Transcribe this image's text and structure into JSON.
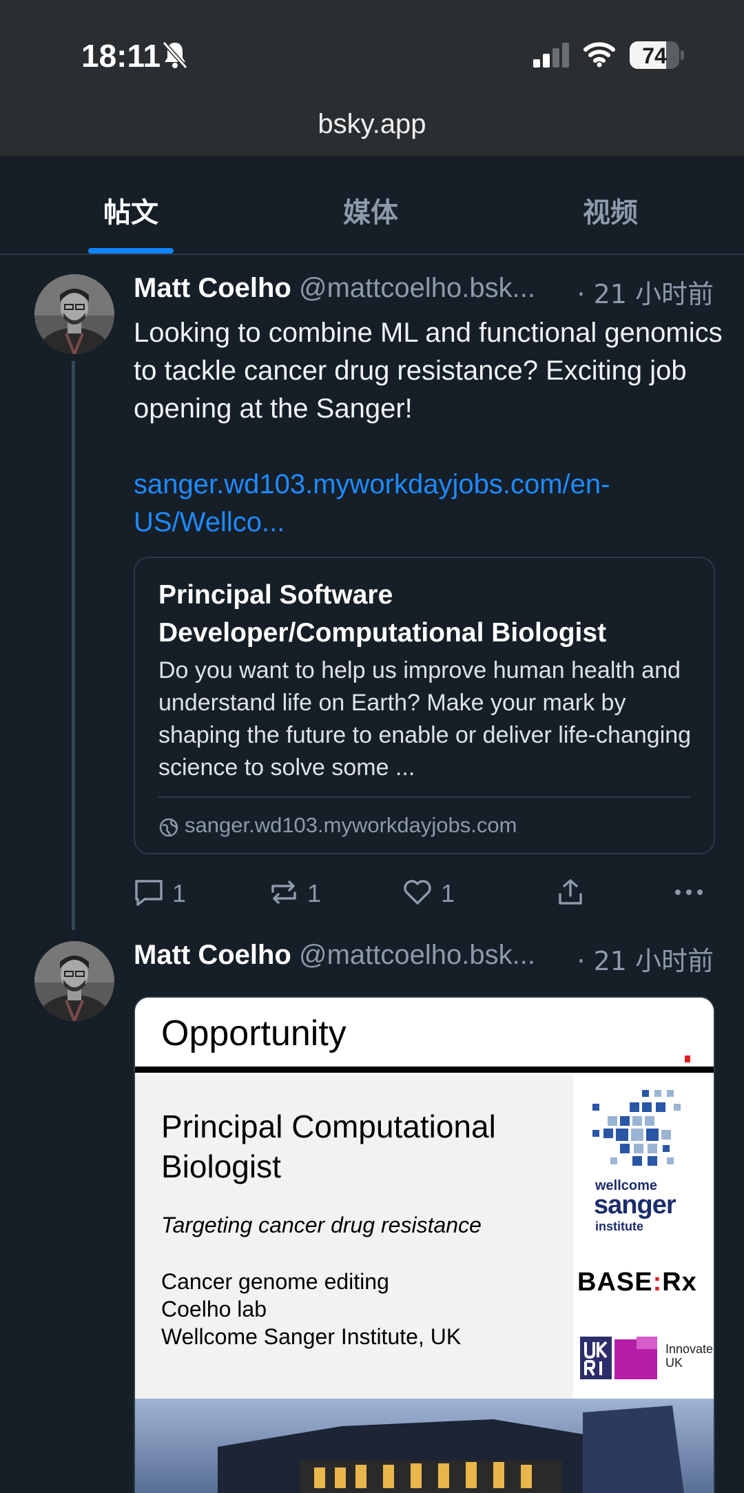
{
  "status_bar": {
    "time": "18:11",
    "battery_level": "74",
    "battery_fraction": 0.74,
    "icons": [
      "bell-slash-icon",
      "cellular-signal-icon",
      "wifi-icon",
      "battery-icon"
    ]
  },
  "browser": {
    "url": "bsky.app"
  },
  "tabs": [
    {
      "label": "帖文",
      "active": true
    },
    {
      "label": "媒体",
      "active": false
    },
    {
      "label": "视频",
      "active": false
    }
  ],
  "posts": [
    {
      "author": "Matt Coelho",
      "handle": "@mattcoelho.bsk...",
      "time": "· 21 小时前",
      "text": "Looking to combine ML and functional genomics to tackle cancer drug resistance? Exciting job opening at the Sanger!",
      "link": "sanger.wd103.myworkdayjobs.com/en-US/Wellco...",
      "card": {
        "title": "Principal Software Developer/Computational Biologist",
        "description": "Do you want to help us improve human health and understand life on Earth? Make your mark by shaping the future to enable or deliver life-changing science to solve some ...",
        "domain": "sanger.wd103.myworkdayjobs.com"
      },
      "actions": {
        "reply_count": "1",
        "repost_count": "1",
        "like_count": "1"
      }
    },
    {
      "author": "Matt Coelho",
      "handle": "@mattcoelho.bsk...",
      "time": "· 21 小时前",
      "image": {
        "heading": "Opportunity",
        "title": "Principal Computational Biologist",
        "subtitle": "Targeting cancer drug resistance",
        "lines": "Cancer genome editing\nCoelho lab\nWellcome Sanger Institute, UK",
        "logo_wellcome": "wellcome",
        "logo_sanger": "sanger",
        "logo_institute": "institute",
        "logo_base_left": "BASE",
        "logo_base_colon": ":",
        "logo_base_right": "Rx",
        "logo_innovate": "Innovate\nUK"
      }
    }
  ],
  "colors": {
    "background": "#161e27",
    "accent": "#1083fe",
    "link": "#1e8bff",
    "muted": "#8c9aab"
  }
}
